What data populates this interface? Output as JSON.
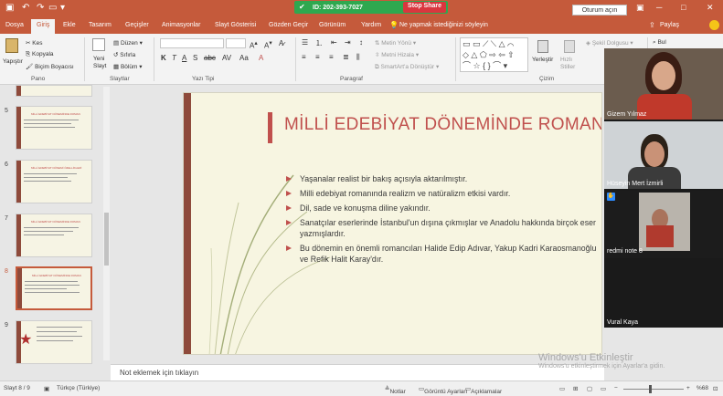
{
  "titlebar": {
    "meeting_id": "ID: 202-393-7027",
    "stop_share": "Stop Share",
    "signin": "Oturum açın",
    "colors": {
      "bar": "#c55a3b",
      "zoom": "#2fa84f",
      "stop": "#d9363e"
    }
  },
  "tabs": [
    {
      "label": "Dosya",
      "active": false
    },
    {
      "label": "Giriş",
      "active": true
    },
    {
      "label": "Ekle",
      "active": false
    },
    {
      "label": "Tasarım",
      "active": false
    },
    {
      "label": "Geçişler",
      "active": false
    },
    {
      "label": "Animasyonlar",
      "active": false
    },
    {
      "label": "Slayt Gösterisi",
      "active": false
    },
    {
      "label": "Gözden Geçir",
      "active": false
    },
    {
      "label": "Görünüm",
      "active": false
    },
    {
      "label": "Yardım",
      "active": false
    }
  ],
  "tellme": "Ne yapmak istediğinizi söyleyin",
  "share": "Paylaş",
  "ribbon": {
    "paste": "Yapıştır",
    "cut": "Kes",
    "copy": "Kopyala",
    "format_painter": "Biçim Boyacısı",
    "clipboard_group": "Pano",
    "new_slide": "Yeni Slayt",
    "layout": "Düzen",
    "reset": "Sıfırla",
    "section": "Bölüm",
    "slides_group": "Slaytlar",
    "font_group": "Yazı Tipi",
    "text_direction": "Metin Yönü",
    "align_text": "Metni Hizala",
    "smartart": "SmartArt'a Dönüştür",
    "paragraph_group": "Paragraf",
    "arrange": "Yerleştir",
    "quick_styles": "Hızlı Stiller",
    "shape_fill": "Şekil Dolgusu",
    "drawing_group": "Çizim",
    "find": "Bul"
  },
  "thumbnails": [
    {
      "num": "5",
      "selected": false,
      "title": "MİLLİ EDEBİYAT DÖNEMİNDE ROMAN"
    },
    {
      "num": "6",
      "selected": false,
      "title": "MİLLİ EDEBİYAT DÖNEMİ ÖZELLİKLERİ"
    },
    {
      "num": "7",
      "selected": false,
      "title": "MİLLİ EDEBİYAT DÖNEMİNDE ROMAN"
    },
    {
      "num": "8",
      "selected": true,
      "title": "MİLLİ EDEBİYAT DÖNEMİNDE ROMAN"
    },
    {
      "num": "9",
      "selected": false,
      "title": ""
    }
  ],
  "slide": {
    "title": "MİLLİ EDEBİYAT DÖNEMİNDE ROMAN",
    "bullets": [
      "Yaşanalar realist bir bakış açısıyla aktarılmıştır.",
      "Milli edebiyat romanında realizm ve natüralizm etkisi vardır.",
      "Dil, sade ve konuşma diline yakındır.",
      "Sanatçılar eserlerinde İstanbul'un dışına çıkmışlar ve Anadolu hakkında birçok eser yazmışlardır.",
      "Bu dönemin en önemli romancıları Halide Edip Adıvar, Yakup Kadri Karaosmanoğlu ve Refik Halit Karay'dır."
    ]
  },
  "notes_placeholder": "Not eklemek için tıklayın",
  "status": {
    "slide_count": "Slayt 8 / 9",
    "language": "Türkçe (Türkiye)",
    "notes": "Notlar",
    "view_settings": "Görüntü Ayarları",
    "comments": "Açıklamalar",
    "zoom": "%68"
  },
  "participants": [
    {
      "name": "Gizem Yılmaz",
      "video": true
    },
    {
      "name": "Hüseyin Mert İzmirli",
      "video": true
    },
    {
      "name": "redmi note 8",
      "video": true
    },
    {
      "name": "Vural Kaya",
      "video": false
    }
  ],
  "watermark": {
    "line1": "Windows'u Etkinleştir",
    "line2": "Windows'u etkinleştirmek için Ayarlar'a gidin."
  }
}
